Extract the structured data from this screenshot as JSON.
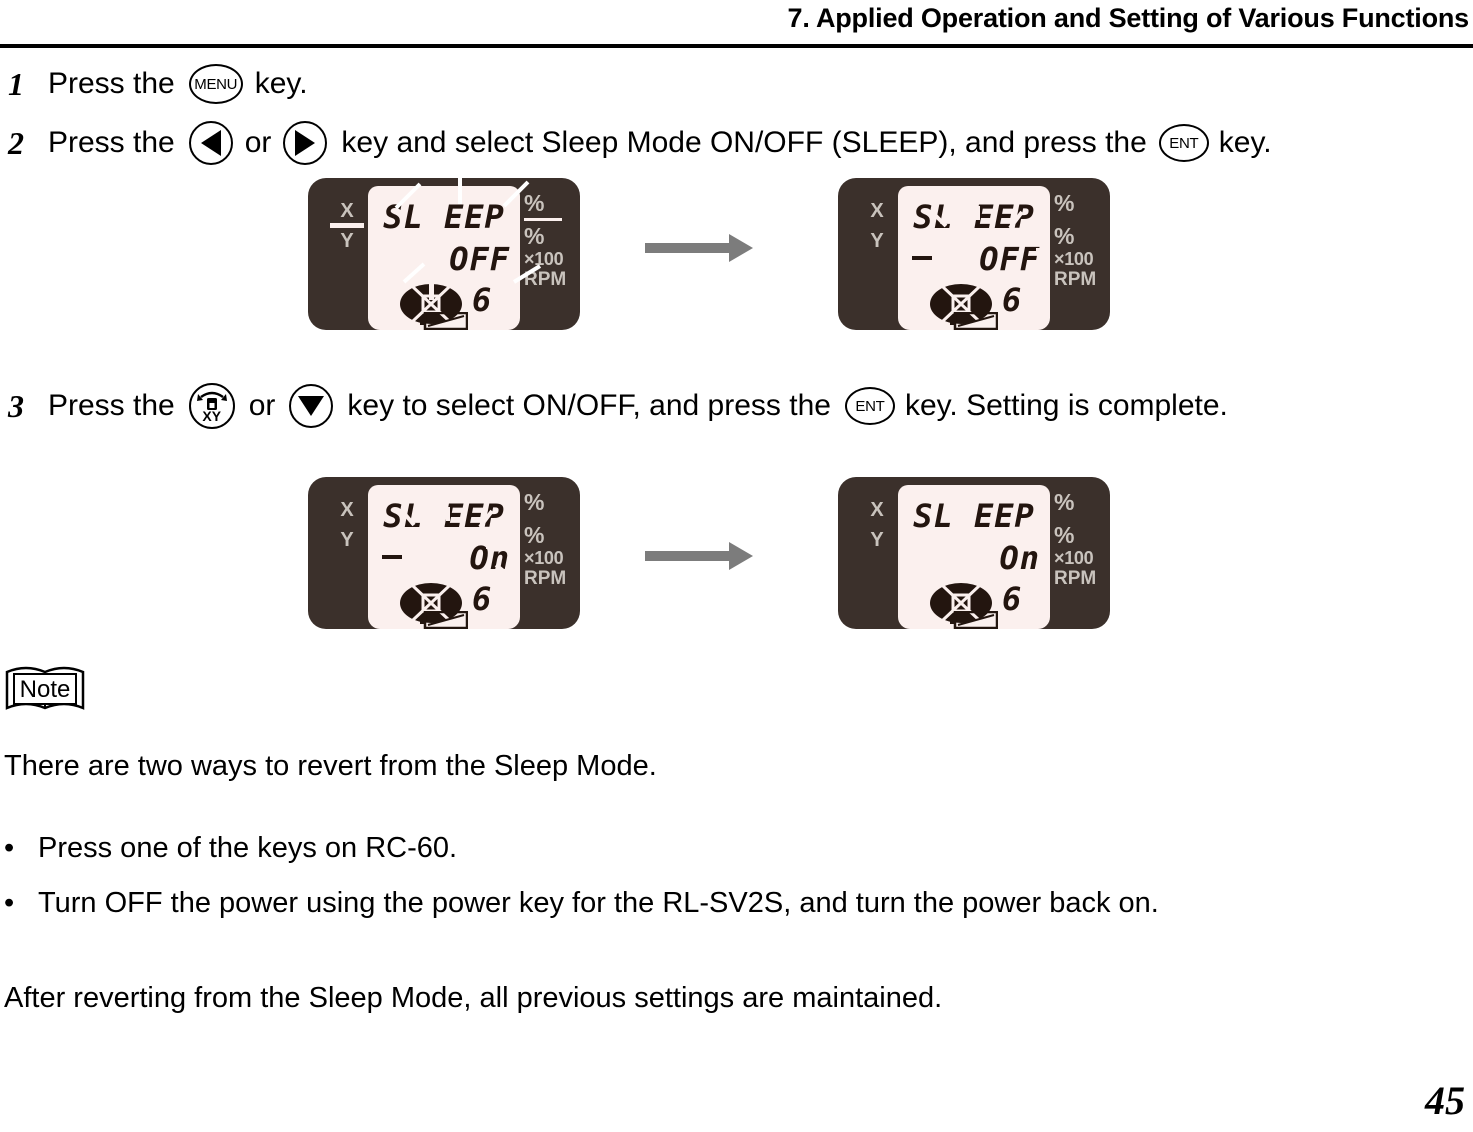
{
  "header": {
    "title": "7.  Applied Operation and Setting of Various Functions"
  },
  "steps": [
    {
      "number": "1",
      "text_before": "Press the",
      "key1": "MENU",
      "text_middle": "",
      "key2": "",
      "text_after": "key."
    },
    {
      "number": "2",
      "text_before": "Press the",
      "key1": "left-arrow",
      "text_middle": "or",
      "key2": "right-arrow",
      "text_after": "key and select Sleep Mode ON/OFF (SLEEP), and press the",
      "key3": "ENT",
      "text_end": "key."
    },
    {
      "number": "3",
      "text_before": "Press the",
      "key1": "xy",
      "text_middle": "or",
      "key2": "down-arrow",
      "text_after": "key to select ON/OFF, and press the",
      "key3": "ENT",
      "text_end": "key. Setting is complete."
    }
  ],
  "keys": {
    "menu_label": "MENU",
    "ent_label": "ENT",
    "xy_label": "XY"
  },
  "displays": [
    {
      "id": "display-step2-before",
      "x_label": "X",
      "y_label": "Y",
      "line1": "SL EEP",
      "line2": "OFF",
      "dash": false,
      "number": "6",
      "pct_top": "%",
      "pct_bottom": "%",
      "x100": "×100",
      "rpm": "RPM",
      "blinking": false,
      "separator_bar": true,
      "callouts": true
    },
    {
      "id": "display-step2-after",
      "x_label": "X",
      "y_label": "Y",
      "line1": "SL EEP",
      "line2": "OFF",
      "dash": true,
      "number": "6",
      "pct_top": "%",
      "pct_bottom": "%",
      "x100": "×100",
      "rpm": "RPM",
      "blinking": true,
      "separator_bar": false,
      "callouts": false
    },
    {
      "id": "display-step3-before",
      "x_label": "X",
      "y_label": "Y",
      "line1": "SL EEP",
      "line2": "On",
      "dash": true,
      "number": "6",
      "pct_top": "%",
      "pct_bottom": "%",
      "x100": "×100",
      "rpm": "RPM",
      "blinking": true,
      "separator_bar": false,
      "callouts": false
    },
    {
      "id": "display-step3-after",
      "x_label": "X",
      "y_label": "Y",
      "line1": "SL EEP",
      "line2": "On",
      "dash": false,
      "number": "6",
      "pct_top": "%",
      "pct_bottom": "%",
      "x100": "×100",
      "rpm": "RPM",
      "blinking": false,
      "separator_bar": false,
      "callouts": false
    }
  ],
  "note": {
    "icon_label": "Note",
    "intro": "There are two ways to revert from the Sleep Mode.",
    "bullet_marker": "•",
    "bullets": [
      "Press one of the keys on RC-60.",
      "Turn OFF the power using the power key for the RL-SV2S, and turn the power back on."
    ],
    "closing": "After reverting from the Sleep Mode, all previous settings are maintained."
  },
  "footer": {
    "page_number": "45"
  },
  "colors": {
    "bezel": "#3b302b",
    "screen": "#fbf0ee",
    "segment": "#23150f",
    "bezel_text": "#c9c3bd",
    "arrow": "#7c7c7c"
  }
}
